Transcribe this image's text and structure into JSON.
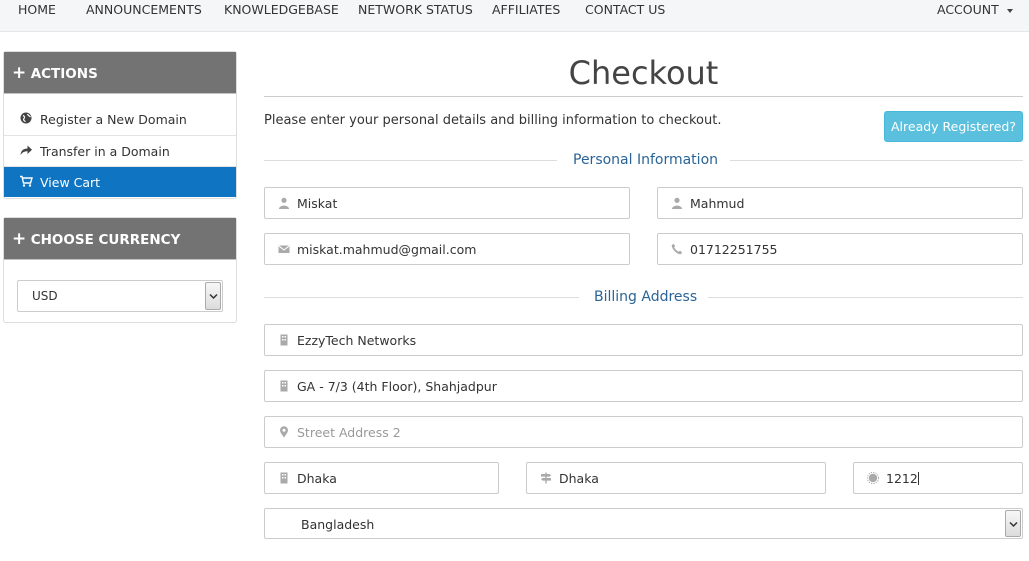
{
  "nav": {
    "home": "HOME",
    "announcements": "ANNOUNCEMENTS",
    "knowledgebase": "KNOWLEDGEBASE",
    "network_status": "NETWORK STATUS",
    "affiliates": "AFFILIATES",
    "contact": "CONTACT US",
    "account": "ACCOUNT"
  },
  "sidebar": {
    "actions_title": "ACTIONS",
    "items": [
      {
        "label": "Register a New Domain",
        "icon": "globe-icon"
      },
      {
        "label": "Transfer in a Domain",
        "icon": "share-arrow-icon"
      },
      {
        "label": "View Cart",
        "icon": "cart-icon",
        "active": true
      }
    ],
    "currency_title": "CHOOSE CURRENCY",
    "currency_value": "USD"
  },
  "main": {
    "title": "Checkout",
    "intro": "Please enter your personal details and billing information to checkout.",
    "already_registered": "Already Registered?",
    "personal_heading": "Personal Information",
    "billing_heading": "Billing Address"
  },
  "personal": {
    "first_name": "Miskat",
    "last_name": "Mahmud",
    "email": "miskat.mahmud@gmail.com",
    "phone": "01712251755"
  },
  "billing": {
    "company": "EzzyTech Networks",
    "address1": "GA - 7/3 (4th Floor), Shahjadpur",
    "address2_placeholder": "Street Address 2",
    "city": "Dhaka",
    "state": "Dhaka",
    "postcode": "1212",
    "country": "Bangladesh"
  },
  "colors": {
    "active_menu": "#0f74c1",
    "panel_header": "#737373",
    "info_button": "#5bc0de",
    "section_heading": "#2a6496"
  }
}
